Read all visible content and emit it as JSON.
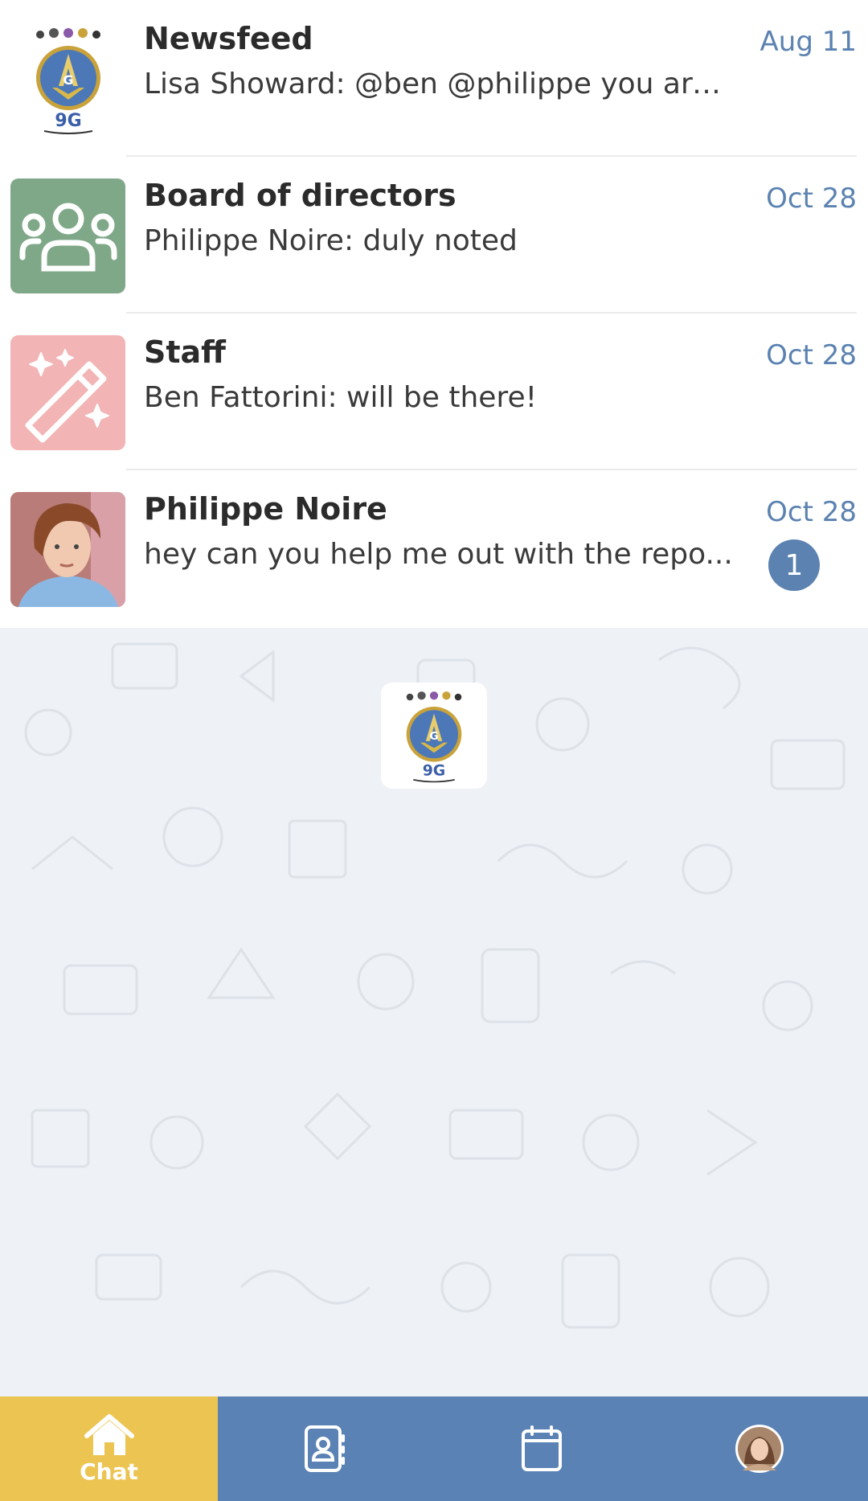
{
  "chats": [
    {
      "name": "Newsfeed",
      "preview": "Lisa Showard: @ben @philippe you are ...",
      "date": "Aug 11",
      "avatar": "masonic-logo-icon"
    },
    {
      "name": "Board of directors",
      "preview": "Philippe Noire: duly noted",
      "date": "Oct 28",
      "avatar": "group-icon",
      "avatar_color": "#7fa888"
    },
    {
      "name": "Staff",
      "preview": "Ben Fattorini: will be there!",
      "date": "Oct 28",
      "avatar": "magic-wand-icon",
      "avatar_color": "#f2b4b4"
    },
    {
      "name": "Philippe Noire",
      "preview": "hey can you help me out with the repo...",
      "date": "Oct 28",
      "avatar": "user-photo",
      "unread": "1"
    }
  ],
  "tabbar": {
    "chat_label": "Chat",
    "active_color": "#ecc451",
    "bar_color": "#5b82b5",
    "icons": [
      "home-icon",
      "contacts-icon",
      "calendar-icon",
      "profile-avatar"
    ]
  },
  "logo_text": "9G",
  "accent": "#5b82b0"
}
